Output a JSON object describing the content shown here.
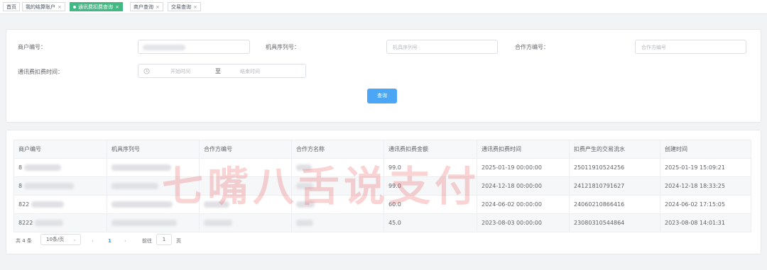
{
  "tabs": [
    {
      "label": "首页"
    },
    {
      "label": "我的结算账户"
    },
    {
      "label": "通讯费扣费查询"
    },
    {
      "label": "商户查询"
    },
    {
      "label": "交易查询"
    }
  ],
  "close_glyph": "×",
  "filters": {
    "merchant_no_label": "商户编号：",
    "serial_no_label": "机具序列号：",
    "serial_no_placeholder": "机具序列号",
    "partner_no_label": "合作方编号：",
    "partner_no_placeholder": "合作方编号",
    "deduct_time_label": "通讯费扣费时间：",
    "start_placeholder": "开始时间",
    "range_separator": "至",
    "end_placeholder": "结束时间",
    "query_button": "查询"
  },
  "table": {
    "columns": [
      "商户编号",
      "机具序列号",
      "合作方编号",
      "合作方名称",
      "通讯费扣费金额",
      "通讯费扣费时间",
      "扣费产生的交易流水",
      "创建时间"
    ],
    "rows": [
      {
        "merchant_prefix": "8",
        "amount": "99.0",
        "deduct_time": "2025-01-19 00:00:00",
        "trade_no": "25011910524256",
        "created": "2025-01-19 15:09:21"
      },
      {
        "merchant_prefix": "8",
        "amount": "99.0",
        "deduct_time": "2024-12-18 00:00:00",
        "trade_no": "24121810791627",
        "created": "2024-12-18 18:33:25"
      },
      {
        "merchant_prefix": "822",
        "amount": "60.0",
        "deduct_time": "2024-06-02 00:00:00",
        "trade_no": "24060210866416",
        "created": "2024-06-02 17:15:05"
      },
      {
        "merchant_prefix": "8222",
        "amount": "45.0",
        "deduct_time": "2023-08-03 00:00:00",
        "trade_no": "23080310544864",
        "created": "2023-08-08 14:01:31"
      }
    ]
  },
  "pagination": {
    "total": "共 4 条",
    "page_size": "10条/页",
    "current_page": "1",
    "goto_label": "前往",
    "goto_value": "1",
    "page_suffix": "页"
  },
  "watermark": "七嘴八舌说支付",
  "colors": {
    "active_tab": "#42b983",
    "primary": "#4ba7f5",
    "watermark": "#e82828"
  },
  "icons": [
    "clock-icon",
    "chevron-down-icon",
    "chevron-left-icon",
    "chevron-right-icon",
    "close-icon"
  ]
}
